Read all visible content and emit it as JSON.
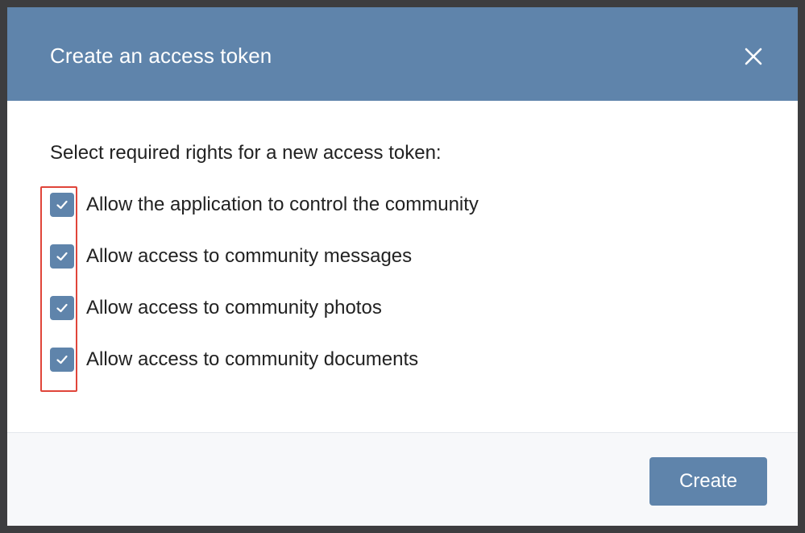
{
  "dialog": {
    "title": "Create an access token",
    "close_icon": "close-icon",
    "prompt": "Select required rights for a new access token:",
    "options": [
      {
        "label": "Allow the application to control the community",
        "checked": true
      },
      {
        "label": "Allow access to community messages",
        "checked": true
      },
      {
        "label": "Allow access to community photos",
        "checked": true
      },
      {
        "label": "Allow access to community documents",
        "checked": true
      }
    ],
    "create_label": "Create"
  },
  "colors": {
    "header": "#5f84ab",
    "checkbox": "#5f84ab",
    "button": "#5f84ab",
    "highlight": "#e0453a"
  }
}
